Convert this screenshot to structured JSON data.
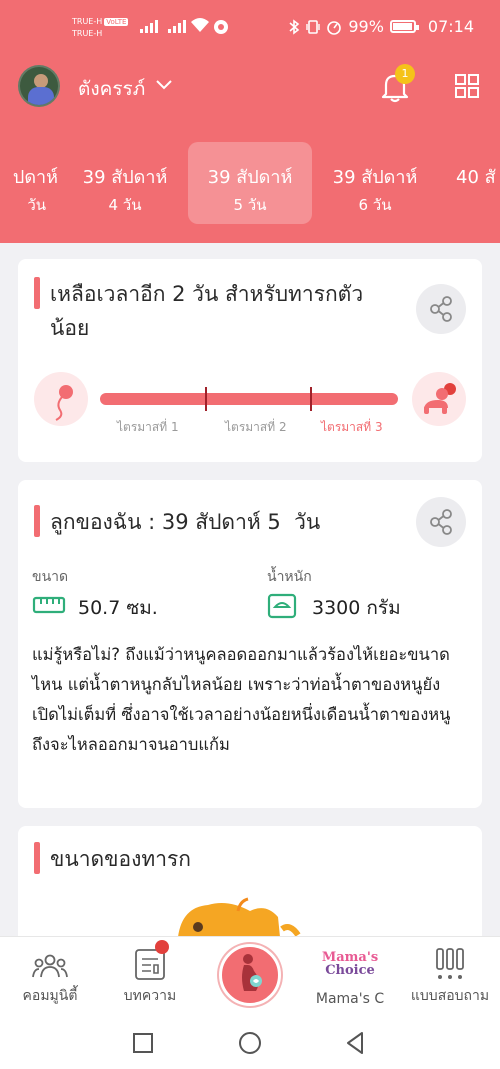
{
  "status_bar": {
    "carrier_1": "TRUE-H",
    "carrier_1_tag": "VoLTE",
    "carrier_2": "TRUE-H",
    "battery": "99%",
    "time": "07:14"
  },
  "header": {
    "username": "ตังครรภ์",
    "notification_count": "1"
  },
  "weeks": [
    {
      "week": "ปดาห์",
      "day": "วัน"
    },
    {
      "week": "39 สัปดาห์",
      "day": "4 วัน"
    },
    {
      "week": "39 สัปดาห์",
      "day": "5 วัน"
    },
    {
      "week": "39 สัปดาห์",
      "day": "6 วัน"
    },
    {
      "week": "40 สั",
      "day": ""
    }
  ],
  "countdown_card": {
    "title": "เหลือเวลาอีก 2 วัน สำหรับทารกตัวน้อย",
    "progress_percent": 99,
    "trimesters": [
      "ไตรมาสที่ 1",
      "ไตรมาสที่ 2",
      "ไตรมาสที่ 3"
    ],
    "active_trimester": 3
  },
  "baby_card": {
    "title": "ลูกของฉัน : 39 สัปดาห์ 5  วัน",
    "size_label": "ขนาด",
    "size_value": "50.7 ซม.",
    "weight_label": "น้ำหนัก",
    "weight_value": "3300 กรัม",
    "description": "แม่รู้หรือไม่? ถึงแม้ว่าหนูคลอดออกมาแล้วร้องไห้เยอะขนาดไหน แต่น้ำตาหนูกลับไหลน้อย เพราะว่าท่อน้ำตาของหนูยังเปิดไม่เต็มที่ ซึ่งอาจใช้เวลาอย่างน้อยหนึ่งเดือนน้ำตาของหนูถึงจะไหลออกมาจนอาบแก้ม"
  },
  "size_card": {
    "title": "ขนาดของทารก"
  },
  "bottom_nav": {
    "community": "คอมมูนิตี้",
    "articles": "บทความ",
    "mamas_choice_logo_1": "Mama's",
    "mamas_choice_logo_2": "Choice",
    "mamas_choice": "Mama's C",
    "quiz": "แบบสอบถาม"
  },
  "colors": {
    "primary": "#f26d72",
    "background": "#f1f1f4",
    "badge_yellow": "#f5c219"
  }
}
